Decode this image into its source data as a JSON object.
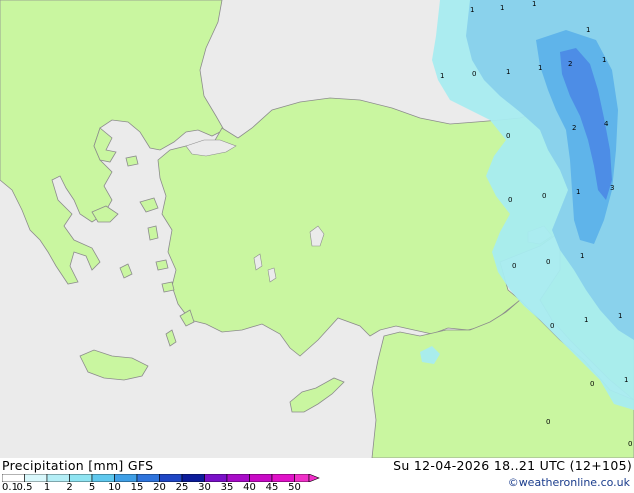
{
  "map": {
    "colors": {
      "sea": "#ebebeb",
      "land": "#c9f6a0",
      "coast": "#8c8c8c",
      "precip_light": "#a8ecf0",
      "precip_mid": "#8ad2ec",
      "precip_high": "#5fb4ea",
      "precip_max": "#4d8de6"
    },
    "cell_values": [
      "1",
      "1",
      "1",
      "1",
      "1",
      "0",
      "1",
      "1",
      "2",
      "1",
      "0",
      "2",
      "4",
      "1",
      "0",
      "0",
      "3",
      "1",
      "0",
      "0",
      "1",
      "0",
      "1",
      "1",
      "0",
      "0",
      "0"
    ]
  },
  "footer": {
    "title": "Precipitation [mm]  GFS",
    "run_time": "Su 12-04-2026 18..21 UTC (12+105)",
    "credit": "©weatheronline.co.uk"
  },
  "legend": {
    "ticks": [
      "0.1",
      "0.5",
      "1",
      "2",
      "5",
      "10",
      "15",
      "20",
      "25",
      "30",
      "35",
      "40",
      "45",
      "50"
    ],
    "colors": [
      "#ffffff",
      "#d9f8fc",
      "#b4eef6",
      "#8fe4f2",
      "#5fc8ee",
      "#3f9fe6",
      "#2f74dc",
      "#1f46c4",
      "#0c1c9a",
      "#7a10c8",
      "#a80cc8",
      "#c80ac6",
      "#e012c8",
      "#f030c8"
    ]
  }
}
